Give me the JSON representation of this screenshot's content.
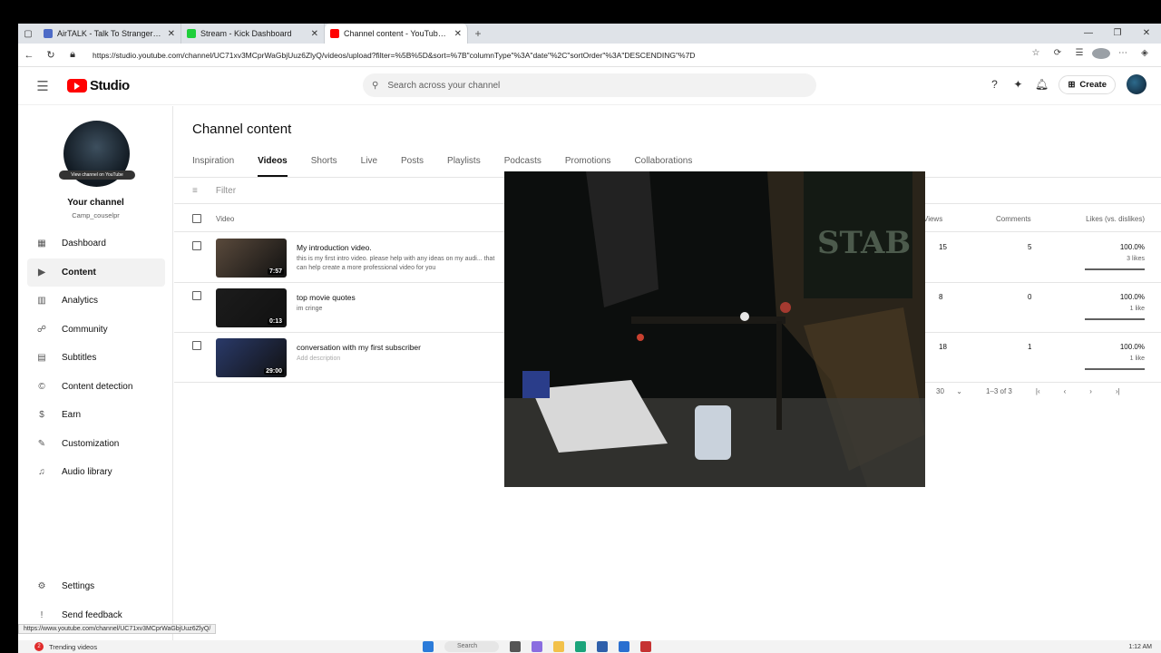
{
  "browser": {
    "tabs": [
      {
        "title": "AirTALK - Talk To Strangers | Voice",
        "color": "#4d6bc7"
      },
      {
        "title": "Stream - Kick Dashboard",
        "color": "#1fcf3a"
      },
      {
        "title": "Channel content - YouTube Studio",
        "color": "#ff0000"
      }
    ],
    "url": "https://studio.youtube.com/channel/UC71xv3MCprWaGbjUuz6ZlyQ/videos/upload?filter=%5B%5D&sort=%7B\"columnType\"%3A\"date\"%2C\"sortOrder\"%3A\"DESCENDING\"%7D",
    "status_url": "https://www.youtube.com/channel/UC71xv3MCprWaGbjUuz6ZlyQ/"
  },
  "header": {
    "logo_text": "Studio",
    "search_placeholder": "Search across your channel",
    "create_label": "Create"
  },
  "sidebar": {
    "view_channel_label": "View channel on YouTube",
    "your_channel": "Your channel",
    "handle": "Camp_couselpr",
    "items": [
      {
        "label": "Dashboard",
        "icon": "dashboard-icon",
        "glyph": "▦",
        "active": false
      },
      {
        "label": "Content",
        "icon": "content-icon",
        "glyph": "▶",
        "active": true
      },
      {
        "label": "Analytics",
        "icon": "analytics-icon",
        "glyph": "▥",
        "active": false
      },
      {
        "label": "Community",
        "icon": "community-icon",
        "glyph": "☍",
        "active": false
      },
      {
        "label": "Subtitles",
        "icon": "subtitles-icon",
        "glyph": "▤",
        "active": false
      },
      {
        "label": "Content detection",
        "icon": "copyright-icon",
        "glyph": "©",
        "active": false
      },
      {
        "label": "Earn",
        "icon": "earn-icon",
        "glyph": "$",
        "active": false
      },
      {
        "label": "Customization",
        "icon": "customization-icon",
        "glyph": "✎",
        "active": false
      },
      {
        "label": "Audio library",
        "icon": "audio-library-icon",
        "glyph": "♫",
        "active": false
      }
    ],
    "bottom_items": [
      {
        "label": "Settings",
        "icon": "settings-icon",
        "glyph": "⚙"
      },
      {
        "label": "Send feedback",
        "icon": "feedback-icon",
        "glyph": "!"
      }
    ]
  },
  "main": {
    "title": "Channel content",
    "tabs": [
      "Inspiration",
      "Videos",
      "Shorts",
      "Live",
      "Posts",
      "Playlists",
      "Podcasts",
      "Promotions",
      "Collaborations"
    ],
    "active_tab": "Videos",
    "filter_placeholder": "Filter",
    "columns": {
      "video": "Video",
      "views": "Views",
      "comments": "Comments",
      "likes": "Likes (vs. dislikes)"
    },
    "rows": [
      {
        "title": "My introduction video.",
        "description": "this is my first intro video. please help with any ideas on my audi... that can help create a more professional video for you",
        "duration": "7:57",
        "views": "15",
        "comments": "5",
        "likes_pct": "100.0%",
        "likes_sub": "3 likes",
        "likes_fraction": 1.0,
        "thumb": "#5a4a3c"
      },
      {
        "title": "top movie quotes",
        "description": "im cringe",
        "duration": "0:13",
        "views": "8",
        "comments": "0",
        "likes_pct": "100.0%",
        "likes_sub": "1 like",
        "likes_fraction": 1.0,
        "thumb": "#1c1c1c"
      },
      {
        "title": "conversation with my first subscriber",
        "description": "Add description",
        "duration": "29:00",
        "views": "18",
        "comments": "1",
        "likes_pct": "100.0%",
        "likes_sub": "1 like",
        "likes_fraction": 1.0,
        "thumb": "#2a3a6a"
      }
    ],
    "pagination": {
      "rows_per_page": "30",
      "range": "1–3 of 3"
    }
  },
  "taskbar": {
    "trending_label": "Trending videos",
    "trending_badge": "2",
    "search_label": "Search",
    "clock": "1:12 AM"
  }
}
